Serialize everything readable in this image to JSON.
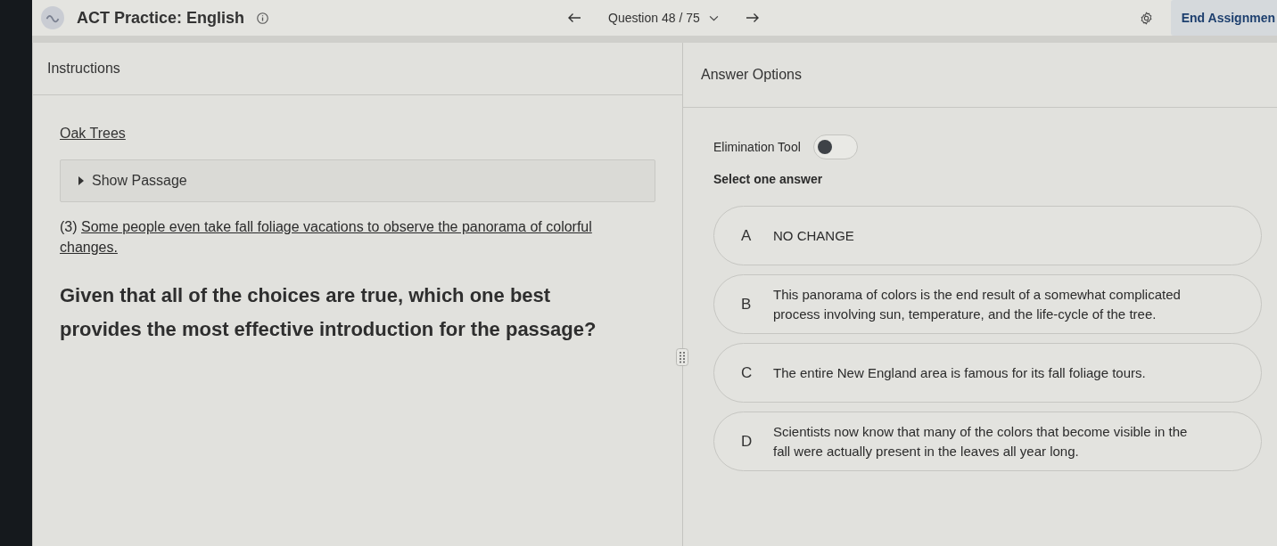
{
  "header": {
    "title": "ACT Practice: English",
    "question_label": "Question 48 / 75",
    "end_button": "End Assignmen"
  },
  "instructions": {
    "heading": "Instructions",
    "passage_title": "Oak Trees",
    "show_passage": {
      "label": "Show Passage",
      "expanded": false
    },
    "excerpt": {
      "number": "(3)",
      "text": "Some people even take fall foliage vacations to observe the panorama of colorful changes."
    },
    "question": "Given that all of the choices are true, which one best provides the most effective introduction for the passage?"
  },
  "answers": {
    "heading": "Answer Options",
    "elimination_tool": {
      "label": "Elimination Tool",
      "on": false
    },
    "prompt": "Select one answer",
    "options": [
      {
        "letter": "A",
        "text": "NO CHANGE",
        "selected": false
      },
      {
        "letter": "B",
        "text": "This panorama of colors is the end result of a somewhat complicated process involving sun, temperature, and the life-cycle of the tree.",
        "selected": false
      },
      {
        "letter": "C",
        "text": "The entire New England area is famous for its fall foliage tours.",
        "selected": false
      },
      {
        "letter": "D",
        "text": "Scientists now know that many of the colors that become visible in the fall were actually present in the leaves all year long.",
        "selected": false
      }
    ]
  }
}
